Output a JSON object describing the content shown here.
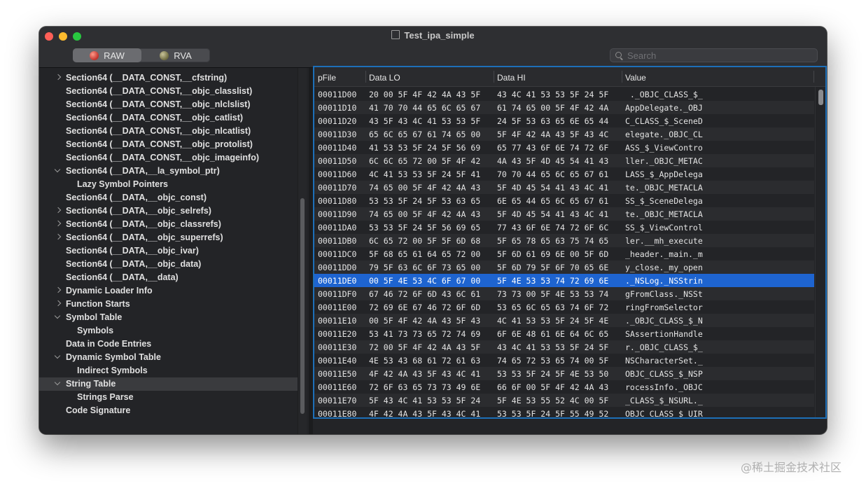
{
  "window": {
    "title": "Test_ipa_simple"
  },
  "toolbar": {
    "raw_label": "RAW",
    "rva_label": "RVA",
    "search_placeholder": "Search"
  },
  "sidebar": {
    "items": [
      {
        "label": "Section64 (__DATA_CONST,__cfstring)",
        "level": 0,
        "disclosure": "right"
      },
      {
        "label": "Section64 (__DATA_CONST,__objc_classlist)",
        "level": 0,
        "disclosure": "none"
      },
      {
        "label": "Section64 (__DATA_CONST,__objc_nlclslist)",
        "level": 0,
        "disclosure": "none"
      },
      {
        "label": "Section64 (__DATA_CONST,__objc_catlist)",
        "level": 0,
        "disclosure": "none"
      },
      {
        "label": "Section64 (__DATA_CONST,__objc_nlcatlist)",
        "level": 0,
        "disclosure": "none"
      },
      {
        "label": "Section64 (__DATA_CONST,__objc_protolist)",
        "level": 0,
        "disclosure": "none"
      },
      {
        "label": "Section64 (__DATA_CONST,__objc_imageinfo)",
        "level": 0,
        "disclosure": "none"
      },
      {
        "label": "Section64 (__DATA,__la_symbol_ptr)",
        "level": 0,
        "disclosure": "down"
      },
      {
        "label": "Lazy Symbol Pointers",
        "level": 1,
        "disclosure": "none"
      },
      {
        "label": "Section64 (__DATA,__objc_const)",
        "level": 0,
        "disclosure": "none"
      },
      {
        "label": "Section64 (__DATA,__objc_selrefs)",
        "level": 0,
        "disclosure": "right"
      },
      {
        "label": "Section64 (__DATA,__objc_classrefs)",
        "level": 0,
        "disclosure": "right"
      },
      {
        "label": "Section64 (__DATA,__objc_superrefs)",
        "level": 0,
        "disclosure": "right"
      },
      {
        "label": "Section64 (__DATA,__objc_ivar)",
        "level": 0,
        "disclosure": "none"
      },
      {
        "label": "Section64 (__DATA,__objc_data)",
        "level": 0,
        "disclosure": "none"
      },
      {
        "label": "Section64 (__DATA,__data)",
        "level": 0,
        "disclosure": "none"
      },
      {
        "label": "Dynamic Loader Info",
        "level": 0,
        "disclosure": "right"
      },
      {
        "label": "Function Starts",
        "level": 0,
        "disclosure": "right"
      },
      {
        "label": "Symbol Table",
        "level": 0,
        "disclosure": "down"
      },
      {
        "label": "Symbols",
        "level": 1,
        "disclosure": "none"
      },
      {
        "label": "Data in Code Entries",
        "level": 0,
        "disclosure": "none"
      },
      {
        "label": "Dynamic Symbol Table",
        "level": 0,
        "disclosure": "down"
      },
      {
        "label": "Indirect Symbols",
        "level": 1,
        "disclosure": "none"
      },
      {
        "label": "String Table",
        "level": 0,
        "disclosure": "down",
        "selected": true
      },
      {
        "label": "Strings Parse",
        "level": 1,
        "disclosure": "none"
      },
      {
        "label": "Code Signature",
        "level": 0,
        "disclosure": "none"
      }
    ]
  },
  "table": {
    "columns": [
      "pFile",
      "Data LO",
      "Data HI",
      "Value"
    ],
    "selected_index": 14,
    "rows": [
      [
        "00011D00",
        "20 00 5F 4F 42 4A 43 5F",
        "43 4C 41 53 53 5F 24 5F",
        " ._OBJC_CLASS_$_"
      ],
      [
        "00011D10",
        "41 70 70 44 65 6C 65 67",
        "61 74 65 00 5F 4F 42 4A",
        "AppDelegate._OBJ"
      ],
      [
        "00011D20",
        "43 5F 43 4C 41 53 53 5F",
        "24 5F 53 63 65 6E 65 44",
        "C_CLASS_$_SceneD"
      ],
      [
        "00011D30",
        "65 6C 65 67 61 74 65 00",
        "5F 4F 42 4A 43 5F 43 4C",
        "elegate._OBJC_CL"
      ],
      [
        "00011D40",
        "41 53 53 5F 24 5F 56 69",
        "65 77 43 6F 6E 74 72 6F",
        "ASS_$_ViewContro"
      ],
      [
        "00011D50",
        "6C 6C 65 72 00 5F 4F 42",
        "4A 43 5F 4D 45 54 41 43",
        "ller._OBJC_METAC"
      ],
      [
        "00011D60",
        "4C 41 53 53 5F 24 5F 41",
        "70 70 44 65 6C 65 67 61",
        "LASS_$_AppDelega"
      ],
      [
        "00011D70",
        "74 65 00 5F 4F 42 4A 43",
        "5F 4D 45 54 41 43 4C 41",
        "te._OBJC_METACLA"
      ],
      [
        "00011D80",
        "53 53 5F 24 5F 53 63 65",
        "6E 65 44 65 6C 65 67 61",
        "SS_$_SceneDelega"
      ],
      [
        "00011D90",
        "74 65 00 5F 4F 42 4A 43",
        "5F 4D 45 54 41 43 4C 41",
        "te._OBJC_METACLA"
      ],
      [
        "00011DA0",
        "53 53 5F 24 5F 56 69 65",
        "77 43 6F 6E 74 72 6F 6C",
        "SS_$_ViewControl"
      ],
      [
        "00011DB0",
        "6C 65 72 00 5F 5F 6D 68",
        "5F 65 78 65 63 75 74 65",
        "ler.__mh_execute"
      ],
      [
        "00011DC0",
        "5F 68 65 61 64 65 72 00",
        "5F 6D 61 69 6E 00 5F 6D",
        "_header._main._m"
      ],
      [
        "00011DD0",
        "79 5F 63 6C 6F 73 65 00",
        "5F 6D 79 5F 6F 70 65 6E",
        "y_close._my_open"
      ],
      [
        "00011DE0",
        "00 5F 4E 53 4C 6F 67 00",
        "5F 4E 53 53 74 72 69 6E",
        "._NSLog._NSStrin"
      ],
      [
        "00011DF0",
        "67 46 72 6F 6D 43 6C 61",
        "73 73 00 5F 4E 53 53 74",
        "gFromClass._NSSt"
      ],
      [
        "00011E00",
        "72 69 6E 67 46 72 6F 6D",
        "53 65 6C 65 63 74 6F 72",
        "ringFromSelector"
      ],
      [
        "00011E10",
        "00 5F 4F 42 4A 43 5F 43",
        "4C 41 53 53 5F 24 5F 4E",
        "._OBJC_CLASS_$_N"
      ],
      [
        "00011E20",
        "53 41 73 73 65 72 74 69",
        "6F 6E 48 61 6E 64 6C 65",
        "SAssertionHandle"
      ],
      [
        "00011E30",
        "72 00 5F 4F 42 4A 43 5F",
        "43 4C 41 53 53 5F 24 5F",
        "r._OBJC_CLASS_$_"
      ],
      [
        "00011E40",
        "4E 53 43 68 61 72 61 63",
        "74 65 72 53 65 74 00 5F",
        "NSCharacterSet._"
      ],
      [
        "00011E50",
        "4F 42 4A 43 5F 43 4C 41",
        "53 53 5F 24 5F 4E 53 50",
        "OBJC_CLASS_$_NSP"
      ],
      [
        "00011E60",
        "72 6F 63 65 73 73 49 6E",
        "66 6F 00 5F 4F 42 4A 43",
        "rocessInfo._OBJC"
      ],
      [
        "00011E70",
        "5F 43 4C 41 53 53 5F 24",
        "5F 4E 53 55 52 4C 00 5F",
        "_CLASS_$_NSURL._"
      ],
      [
        "00011E80",
        "4F 42 4A 43 5F 43 4C 41",
        "53 53 5F 24 5F 55 49 52",
        "OBJC_CLASS_$_UIR"
      ]
    ]
  },
  "watermark": "@稀土掘金技术社区"
}
